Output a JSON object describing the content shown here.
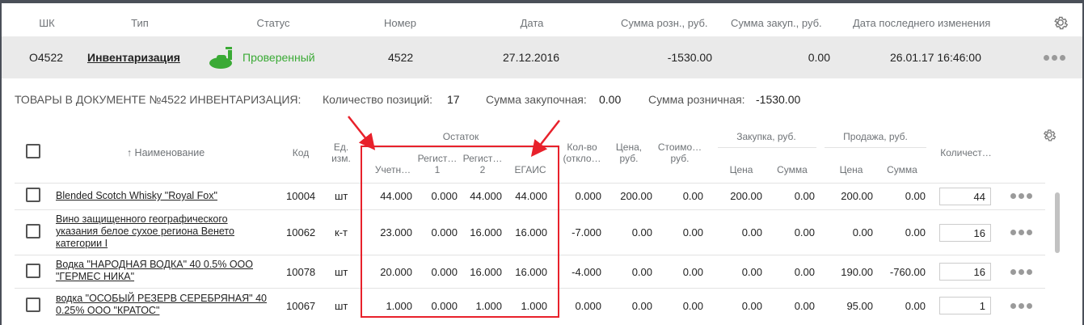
{
  "doc_header": {
    "columns": [
      "ШК",
      "Тип",
      "Статус",
      "Номер",
      "Дата",
      "Сумма розн., руб.",
      "Сумма закуп., руб.",
      "Дата последнего изменения"
    ],
    "settings_icon": "gear-icon"
  },
  "doc_row": {
    "shk": "O4522",
    "type": "Инвентаризация",
    "status": "Проверенный",
    "status_icon": "flask-icon",
    "status_color": "#3aaa35",
    "number": "4522",
    "date": "27.12.2016",
    "retail_sum": "-1530.00",
    "purchase_sum": "0.00",
    "modified": "26.01.17 16:46:00",
    "more_icon": "more-dots-icon"
  },
  "summary": {
    "title": "ТОВАРЫ В ДОКУМЕНТЕ №4522 ИНВЕНТАРИЗАЦИЯ:",
    "count_label": "Количество позиций:",
    "count_value": "17",
    "purchase_label": "Сумма закупочная:",
    "purchase_value": "0.00",
    "retail_label": "Сумма розничная:",
    "retail_value": "-1530.00"
  },
  "table_header": {
    "name": "↑ Наименование",
    "code": "Код",
    "unit": "Ед. изм.",
    "remainder_group": "Остаток",
    "rem_account": "Учетн…",
    "rem_reg1": "Регист… 1",
    "rem_reg2": "Регист… 2",
    "rem_egais": "ЕГАИС",
    "deviation": "Кол-во (откло…",
    "price": "Цена, руб.",
    "cost": "Стоимо… руб.",
    "purchase_group": "Закупка, руб.",
    "purchase_price": "Цена",
    "purchase_sum": "Сумма",
    "sale_group": "Продажа, руб.",
    "sale_price": "Цена",
    "sale_sum": "Сумма",
    "quantity": "Количест…"
  },
  "rows": [
    {
      "name": "Blended Scotch Whisky \"Royal Fox\"",
      "code": "10004",
      "unit": "шт",
      "account": "44.000",
      "reg1": "0.000",
      "reg2": "44.000",
      "egais": "44.000",
      "deviation": "0.000",
      "price": "200.00",
      "cost": "0.00",
      "p_price": "200.00",
      "p_sum": "0.00",
      "s_price": "200.00",
      "s_sum": "0.00",
      "qty": "44"
    },
    {
      "name": "Вино защищенного географического указания белое сухое региона Венето категории I",
      "code": "10062",
      "unit": "к-т",
      "account": "23.000",
      "reg1": "0.000",
      "reg2": "16.000",
      "egais": "16.000",
      "deviation": "-7.000",
      "price": "0.00",
      "cost": "0.00",
      "p_price": "0.00",
      "p_sum": "0.00",
      "s_price": "0.00",
      "s_sum": "0.00",
      "qty": "16"
    },
    {
      "name": "Водка \"НАРОДНАЯ ВОДКА\" 40 0.5% ООО \"ГЕРМЕС НИКА\"",
      "code": "10078",
      "unit": "шт",
      "account": "20.000",
      "reg1": "0.000",
      "reg2": "16.000",
      "egais": "16.000",
      "deviation": "-4.000",
      "price": "0.00",
      "cost": "0.00",
      "p_price": "0.00",
      "p_sum": "0.00",
      "s_price": "190.00",
      "s_sum": "-760.00",
      "qty": "16"
    },
    {
      "name": "водка \"ОСОБЫЙ РЕЗЕРВ СЕРЕБРЯНАЯ\" 40 0.25% ООО \"КРАТОС\"",
      "code": "10067",
      "unit": "шт",
      "account": "1.000",
      "reg1": "0.000",
      "reg2": "1.000",
      "egais": "1.000",
      "deviation": "0.000",
      "price": "0.00",
      "cost": "0.00",
      "p_price": "0.00",
      "p_sum": "0.00",
      "s_price": "95.00",
      "s_sum": "0.00",
      "qty": "1"
    }
  ],
  "annotation_color": "#e8212b"
}
